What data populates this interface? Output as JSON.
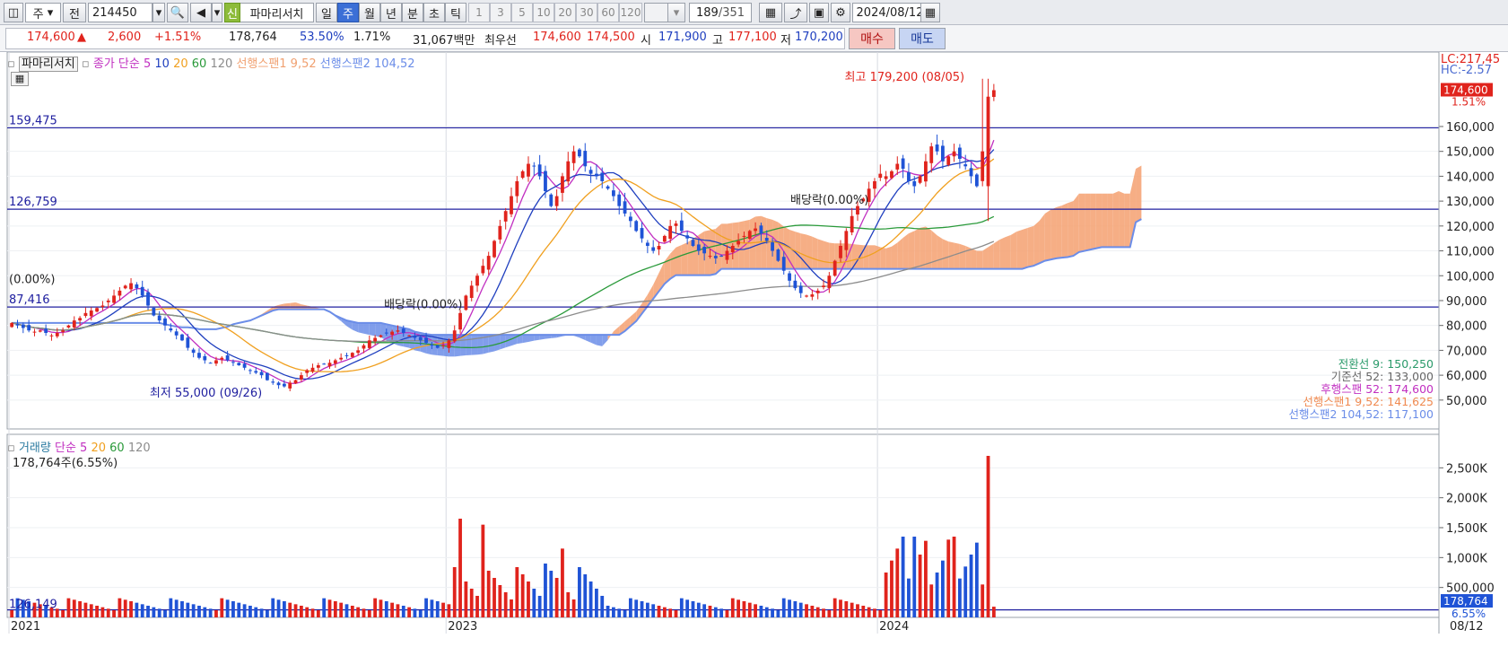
{
  "toolbar": {
    "market": "주",
    "prev_label": "전",
    "code": "214450",
    "tag_new": "신",
    "stock_name": "파마리서치",
    "periods": [
      "일",
      "주",
      "월",
      "년",
      "분",
      "초",
      "틱"
    ],
    "active_period": "주",
    "minute_steps": [
      "1",
      "3",
      "5",
      "10",
      "20",
      "30",
      "60",
      "120"
    ],
    "count_display": "189",
    "count_total": "/351",
    "date": "2024/08/12"
  },
  "info": {
    "price": "174,600",
    "arrow": "▲",
    "change": "2,600",
    "change_pct": "+1.51%",
    "volume": "178,764",
    "ratio1": "53.50%",
    "ratio2": "1.71%",
    "amount": "31,067백만",
    "bid_label": "최우선",
    "ask_price": "174,600",
    "bid_price": "174,500",
    "open_label": "시",
    "open": "171,900",
    "high_label": "고",
    "high": "177,100",
    "low_label": "저",
    "low": "170,200",
    "buy": "매수",
    "sell": "매도"
  },
  "colors": {
    "up": "#e0231c",
    "down": "#1f53d6",
    "ma5": "#c12fc1",
    "ma10": "#1f3fbf",
    "ma20": "#f0a020",
    "ma60": "#2a9a3a",
    "ma120": "#8c8c8c",
    "span1": "#f4a070",
    "span2": "#6b8de8",
    "hline": "#2020a0"
  },
  "price_panel": {
    "legend": {
      "name": "파마리서치",
      "close_label": "종가",
      "ma_label": "단순",
      "ma_periods": [
        "5",
        "10",
        "20",
        "60",
        "120"
      ],
      "span1": "선행스팬1 9,52",
      "span2": "선행스팬2 104,52"
    },
    "hlines": [
      {
        "value": 159475,
        "label": "159,475"
      },
      {
        "value": 126759,
        "label": "126,759"
      },
      {
        "value": 87416,
        "label": "87,416"
      }
    ],
    "annotations": {
      "high": "최고 179,200 (08/05)",
      "low": "최저 55,000 (09/26)",
      "dividend1": "배당락(0.00%)",
      "dividend2": "배당락(0.00%)",
      "dividend0": "(0.00%)"
    },
    "right_axis_top": {
      "lc": "LC:217,45",
      "hc": "HC:-2.57",
      "current": "174,600",
      "pct": "1.51%"
    },
    "ichimoku": [
      {
        "label": "전환선 9:",
        "value": "150,250",
        "color": "#2a9a6a"
      },
      {
        "label": "기준선 52:",
        "value": "133,000",
        "color": "#666666"
      },
      {
        "label": "후행스팬 52:",
        "value": "174,600",
        "color": "#c12fc1"
      },
      {
        "label": "선행스팬1 9,52:",
        "value": "141,625",
        "color": "#f08a50"
      },
      {
        "label": "선행스팬2 104,52:",
        "value": "117,100",
        "color": "#6b8de8"
      }
    ]
  },
  "volume_panel": {
    "legend": {
      "name": "거래량",
      "ma_label": "단순",
      "ma_periods": [
        "5",
        "20",
        "60",
        "120"
      ]
    },
    "last": "178,764주(6.55%)",
    "hline_label": "126,149",
    "current": "178,764",
    "pct": "6.55%"
  },
  "x_axis": {
    "labels": [
      "2021",
      "2023",
      "2024"
    ],
    "last": "08/12"
  },
  "chart_data": {
    "type": "candlestick",
    "period": "weekly",
    "price_axis": {
      "min": 45000,
      "max": 220000,
      "ticks": [
        50000,
        60000,
        70000,
        80000,
        90000,
        100000,
        110000,
        120000,
        130000,
        140000,
        150000,
        160000
      ]
    },
    "volume_axis": {
      "min": 0,
      "max": 3000000,
      "ticks": [
        500000,
        1000000,
        1500000,
        2000000,
        2500000
      ],
      "tick_labels": [
        "500,000",
        "1,000K",
        "1,500K",
        "2,000K",
        "2,500K"
      ]
    },
    "x_labels": [
      {
        "index": 0,
        "label": "2021"
      },
      {
        "index": 77,
        "label": "2023"
      },
      {
        "index": 153,
        "label": "2024"
      }
    ],
    "closes": [
      81000,
      80000,
      79000,
      78000,
      77500,
      78000,
      77000,
      76000,
      77000,
      78000,
      80000,
      82000,
      83000,
      85000,
      86000,
      87000,
      88000,
      90000,
      92000,
      94000,
      96000,
      97000,
      95000,
      92000,
      88000,
      84000,
      82000,
      80000,
      78000,
      76000,
      74000,
      71000,
      69000,
      67000,
      66000,
      65000,
      66000,
      67000,
      66000,
      65000,
      64000,
      63000,
      62000,
      61000,
      60000,
      58000,
      57000,
      56000,
      55500,
      57000,
      58000,
      60000,
      62000,
      63000,
      64000,
      64500,
      65000,
      66000,
      67000,
      68000,
      69000,
      70000,
      72000,
      74000,
      75000,
      76000,
      77000,
      77500,
      78000,
      77000,
      76000,
      75000,
      74000,
      73000,
      72000,
      71000,
      72000,
      74000,
      78000,
      85000,
      92000,
      96000,
      100000,
      104000,
      108000,
      114000,
      120000,
      126000,
      132000,
      138000,
      142000,
      145000,
      144000,
      140000,
      134000,
      128000,
      132000,
      140000,
      146000,
      150000,
      148000,
      144000,
      141000,
      140000,
      138000,
      135000,
      132000,
      128000,
      125000,
      122000,
      118000,
      115000,
      112000,
      110000,
      112000,
      116000,
      120000,
      121000,
      118000,
      115000,
      112000,
      110000,
      109000,
      108000,
      107000,
      108000,
      110000,
      112000,
      114000,
      116000,
      118000,
      119000,
      117000,
      114000,
      110000,
      106000,
      102000,
      98000,
      95000,
      93000,
      92000,
      92500,
      94000,
      96000,
      100000,
      106000,
      112000,
      118000,
      124000,
      128000,
      131000,
      135000,
      138000,
      141000,
      140000,
      142000,
      145000,
      143000,
      138000,
      136000,
      140000,
      146000,
      152000,
      150000,
      146000,
      148000,
      150000,
      147000,
      144000,
      140000,
      136000,
      150000,
      172000,
      174600
    ],
    "highs_note": "high 179200 at week of 08/05; low 55000 at week of 09/26"
  }
}
